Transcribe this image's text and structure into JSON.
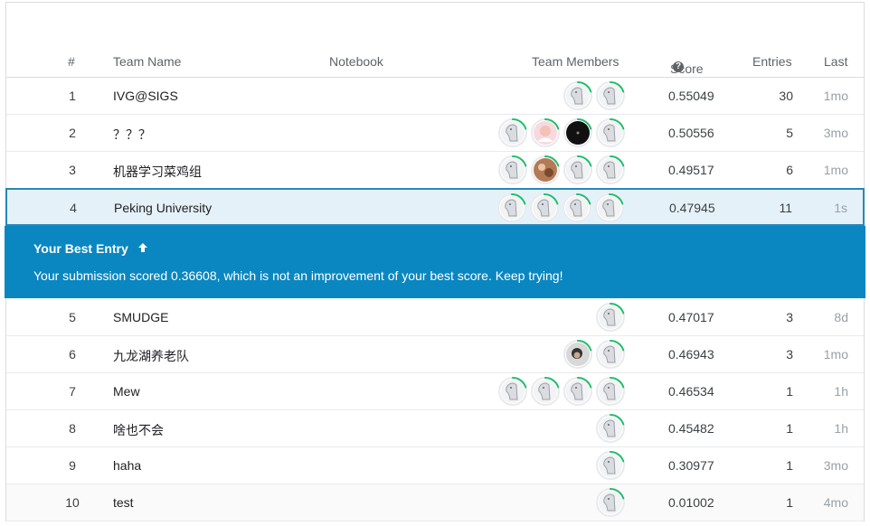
{
  "header": {
    "rank": "#",
    "team_name": "Team Name",
    "notebook": "Notebook",
    "team_members": "Team Members",
    "score": "Score",
    "score_help_icon": "question-circle-icon",
    "entries": "Entries",
    "last": "Last"
  },
  "rows": [
    {
      "rank": "1",
      "name": "IVG@SIGS",
      "score": "0.55049",
      "entries": "30",
      "last": "1mo",
      "members": [
        "default",
        "default"
      ]
    },
    {
      "rank": "2",
      "name": "？？？",
      "score": "0.50556",
      "entries": "5",
      "last": "3mo",
      "members": [
        "default",
        "photo-pink",
        "photo-dark",
        "default"
      ]
    },
    {
      "rank": "3",
      "name": "机器学习菜鸡组",
      "score": "0.49517",
      "entries": "6",
      "last": "1mo",
      "members": [
        "default",
        "photo-brown",
        "default",
        "default"
      ]
    },
    {
      "rank": "4",
      "name": "Peking University",
      "score": "0.47945",
      "entries": "11",
      "last": "1s",
      "members": [
        "default",
        "default",
        "default",
        "default"
      ]
    },
    {
      "rank": "5",
      "name": "SMUDGE",
      "score": "0.47017",
      "entries": "3",
      "last": "8d",
      "members": [
        "default"
      ]
    },
    {
      "rank": "6",
      "name": "九龙湖养老队",
      "score": "0.46943",
      "entries": "3",
      "last": "1mo",
      "members": [
        "photo-face",
        "default"
      ]
    },
    {
      "rank": "7",
      "name": "Mew",
      "score": "0.46534",
      "entries": "1",
      "last": "1h",
      "members": [
        "default",
        "default",
        "default",
        "default"
      ]
    },
    {
      "rank": "8",
      "name": "啥也不会",
      "score": "0.45482",
      "entries": "1",
      "last": "1h",
      "members": [
        "default"
      ]
    },
    {
      "rank": "9",
      "name": "haha",
      "score": "0.30977",
      "entries": "1",
      "last": "3mo",
      "members": [
        "default"
      ]
    },
    {
      "rank": "10",
      "name": "test",
      "score": "0.01002",
      "entries": "1",
      "last": "4mo",
      "members": [
        "default"
      ]
    }
  ],
  "banner": {
    "title": "Your Best Entry",
    "arrow_icon": "arrow-up-icon",
    "message": "Your submission scored 0.36608, which is not an improvement of your best score. Keep trying!"
  },
  "colors": {
    "accent": "#0a87c0",
    "highlight_bg": "#e4f1f8",
    "highlight_border": "#2a86b8",
    "progress_ring": "#20be6b"
  }
}
